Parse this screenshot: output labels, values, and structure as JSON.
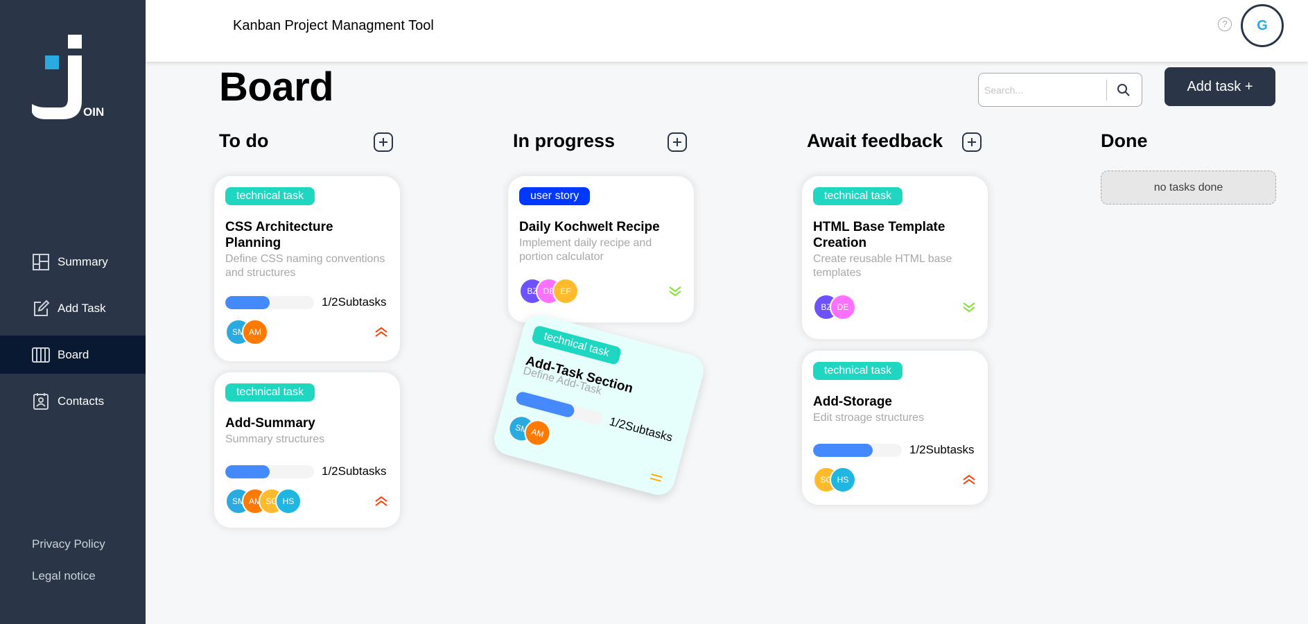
{
  "app": {
    "title": "Kanban Project Managment Tool",
    "logo_text": "OIN",
    "help_label": "?",
    "user_initial": "G"
  },
  "sidebar": {
    "items": [
      {
        "label": "Summary",
        "icon": "summary-icon",
        "active": false
      },
      {
        "label": "Add Task",
        "icon": "edit-icon",
        "active": false
      },
      {
        "label": "Board",
        "icon": "board-icon",
        "active": true
      },
      {
        "label": "Contacts",
        "icon": "contacts-icon",
        "active": false
      }
    ],
    "links": [
      "Privacy Policy",
      "Legal notice"
    ]
  },
  "board": {
    "title": "Board",
    "search_placeholder": "Search...",
    "add_task_label": "Add task +",
    "columns": [
      "To do",
      "In progress",
      "Await feedback",
      "Done"
    ],
    "empty_done": "no tasks done"
  },
  "cards": {
    "todo1": {
      "tag": "technical task",
      "title": "CSS Architecture Planning",
      "desc": "Define CSS naming conventions and structures",
      "progress": 0.5,
      "subtasks": "1/2Subtasks",
      "avatars": [
        {
          "initials": "SM",
          "color": "#29abe2"
        },
        {
          "initials": "AM",
          "color": "#ff7a00"
        }
      ],
      "priority": "urgent"
    },
    "todo2": {
      "tag": "technical task",
      "title": "Add-Summary",
      "desc": "Summary structures",
      "progress": 0.5,
      "subtasks": "1/2Subtasks",
      "avatars": [
        {
          "initials": "SM",
          "color": "#29abe2"
        },
        {
          "initials": "AM",
          "color": "#ff7a00"
        },
        {
          "initials": "SG",
          "color": "#ffbb2b"
        },
        {
          "initials": "HS",
          "color": "#1fb6e2"
        }
      ],
      "priority": "urgent"
    },
    "progress1": {
      "tag": "user story",
      "title": "Daily Kochwelt Recipe",
      "desc": "Implement daily recipe and portion calculator",
      "avatars": [
        {
          "initials": "BZ",
          "color": "#6e52ff"
        },
        {
          "initials": "DE",
          "color": "#fc71ff"
        },
        {
          "initials": "EF",
          "color": "#ffbb2b"
        }
      ],
      "priority": "low"
    },
    "feedback1": {
      "tag": "technical task",
      "title": "HTML Base Template Creation",
      "desc": "Create reusable HTML base templates",
      "avatars": [
        {
          "initials": "BZ",
          "color": "#6e52ff"
        },
        {
          "initials": "DE",
          "color": "#fc71ff"
        }
      ],
      "priority": "low"
    },
    "feedback2": {
      "tag": "technical task",
      "title": "Add-Storage",
      "desc": "Edit stroage structures",
      "progress": 0.67,
      "subtasks": "1/2Subtasks",
      "avatars": [
        {
          "initials": "SG",
          "color": "#ffbb2b"
        },
        {
          "initials": "HS",
          "color": "#1fb6e2"
        }
      ],
      "priority": "urgent"
    },
    "dragged": {
      "tag": "technical task",
      "title": "Add-Task Section",
      "desc": "Define Add-Task",
      "progress": 0.67,
      "subtasks": "1/2Subtasks",
      "avatars": [
        {
          "initials": "SM",
          "color": "#29abe2"
        },
        {
          "initials": "AM",
          "color": "#ff7a00"
        }
      ],
      "priority": "medium"
    }
  },
  "colors": {
    "sidebar": "#2a3647",
    "sidebar_active": "#091931",
    "technical_task": "#1fd7c1",
    "user_story": "#0038ff",
    "progress_fill": "#4589ff",
    "urgent": "#ff3d00",
    "medium": "#ffa800",
    "low": "#7ae229"
  }
}
